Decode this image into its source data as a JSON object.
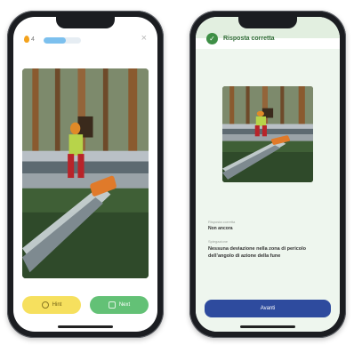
{
  "left_screen": {
    "streak_count": "4",
    "progress_fraction": 0.6,
    "close_symbol": "×",
    "hint_button_label": "Hint",
    "next_button_label": "Next"
  },
  "right_screen": {
    "status_text": "Risposta corretta",
    "check_symbol": "✓",
    "field_1_label": "Risposta corretta",
    "field_1_value": "Non ancora",
    "field_2_label": "Spiegazione",
    "field_2_value": "Nessuna deviazione nella zona di pericolo dell’angolo di azione della fune",
    "continue_button_label": "Avanti"
  },
  "colors": {
    "phone_frame": "#1b1d21",
    "hint_button": "#f6e05e",
    "next_button": "#63c176",
    "correct_green": "#3e8f46",
    "panel_bg": "#eef6ee",
    "continue_button": "#2e4b9e",
    "progress_fill": "#7cc0ee"
  },
  "icons": {
    "streak": "flame-icon",
    "close": "close-icon",
    "status": "check-circle-icon"
  }
}
